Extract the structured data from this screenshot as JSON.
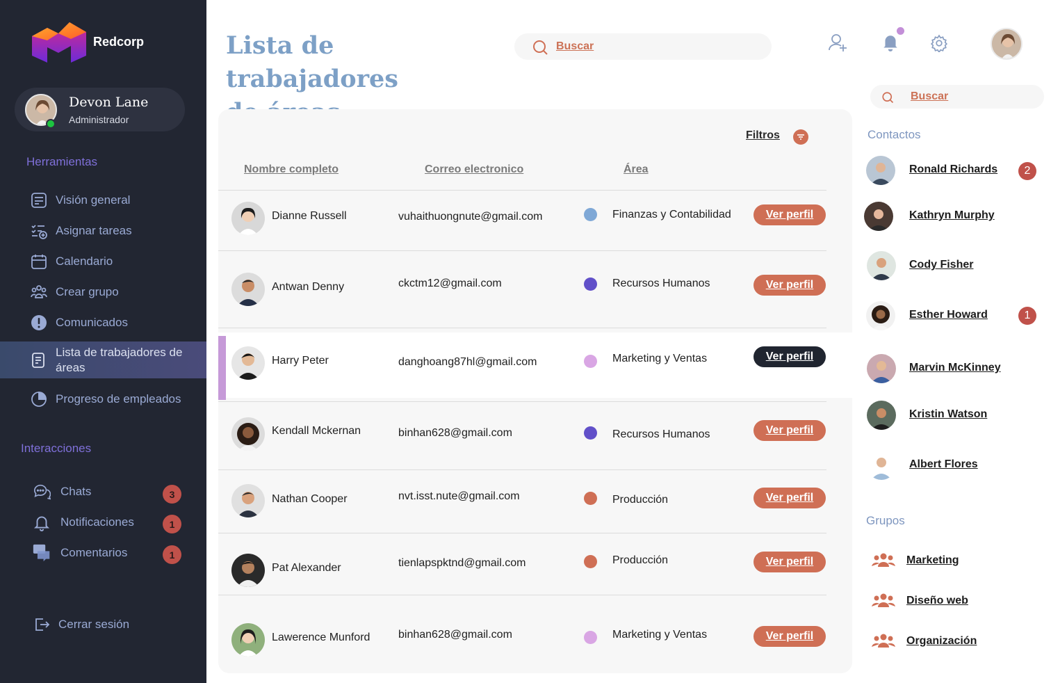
{
  "brand": {
    "name": "Redcorp"
  },
  "user": {
    "name": "Devon Lane",
    "role": "Administrador"
  },
  "sidebar": {
    "tools_title": "Herramientas",
    "tools": [
      {
        "label": "Visión general",
        "icon": "dashboard-icon"
      },
      {
        "label": "Asignar tareas",
        "icon": "task-list-add-icon"
      },
      {
        "label": "Calendario",
        "icon": "calendar-icon"
      },
      {
        "label": "Crear grupo",
        "icon": "group-icon"
      },
      {
        "label": "Comunicados",
        "icon": "exclamation-icon"
      },
      {
        "label": "Lista de trabajadores de áreas",
        "icon": "list-icon",
        "active": true
      },
      {
        "label": "Progreso de empleados",
        "icon": "pie-chart-icon"
      }
    ],
    "interactions_title": "Interacciones",
    "interactions": [
      {
        "label": "Chats",
        "icon": "chat-icon",
        "badge": "3"
      },
      {
        "label": "Notificaciones",
        "icon": "bell-icon",
        "badge": "1"
      },
      {
        "label": "Comentarios",
        "icon": "comments-icon",
        "badge": "1"
      }
    ],
    "logout": "Cerrar sesión"
  },
  "header": {
    "title_line1": "Lista de trabajadores",
    "title_line2": "de áreas",
    "search_label": "Buscar"
  },
  "table": {
    "filters_label": "Filtros",
    "columns": [
      "Nombre completo",
      "Correo electronico",
      "Área"
    ],
    "profile_label": "Ver perfil",
    "rows": [
      {
        "name": "Dianne Russell",
        "email": "vuhaithuongnute@gmail.com",
        "area": "Finanzas y Contabilidad",
        "area_color": "#7fa8d6"
      },
      {
        "name": "Antwan Denny",
        "email": "ckctm12@gmail.com",
        "area": "Recursos Humanos",
        "area_color": "#6150c9"
      },
      {
        "name": "Harry Peter",
        "email": "danghoang87hl@gmail.com",
        "area": "Marketing y Ventas",
        "area_color": "#d9a6e4",
        "selected": true
      },
      {
        "name": "Kendall Mckernan",
        "email": "binhan628@gmail.com",
        "area": "Recursos Humanos",
        "area_color": "#6150c9"
      },
      {
        "name": "Nathan Cooper",
        "email": "nvt.isst.nute@gmail.com",
        "area": "Producción",
        "area_color": "#cf6f55"
      },
      {
        "name": "Pat Alexander",
        "email": "tienlapspktnd@gmail.com",
        "area": "Producción",
        "area_color": "#cf6f55"
      },
      {
        "name": "Lawerence Munford",
        "email": "binhan628@gmail.com",
        "area": "Marketing y Ventas",
        "area_color": "#d9a6e4"
      }
    ]
  },
  "right": {
    "search_label": "Buscar",
    "contacts_title": "Contactos",
    "contacts": [
      {
        "name": "Ronald Richards",
        "badge": "2"
      },
      {
        "name": "Kathryn Murphy"
      },
      {
        "name": "Cody Fisher"
      },
      {
        "name": "Esther Howard",
        "badge": "1"
      },
      {
        "name": "Marvin McKinney"
      },
      {
        "name": "Kristin Watson"
      },
      {
        "name": "Albert Flores"
      }
    ],
    "groups_title": "Grupos",
    "groups": [
      {
        "name": "Marketing"
      },
      {
        "name": "Diseño web"
      },
      {
        "name": "Organización"
      }
    ]
  },
  "colors": {
    "accent": "#cf6f55",
    "sidebar_bg": "#222632",
    "title": "#7da0c6"
  }
}
